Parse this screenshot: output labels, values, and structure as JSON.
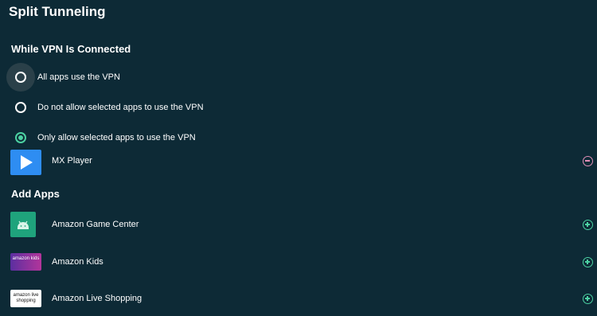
{
  "header": {
    "title": "Split Tunneling"
  },
  "vpn_section": {
    "title": "While VPN Is Connected",
    "options": [
      {
        "label": "All apps use the VPN",
        "selected": false,
        "focused": true
      },
      {
        "label": "Do not allow selected apps to use the VPN",
        "selected": false,
        "focused": false
      },
      {
        "label": "Only allow selected apps to use the VPN",
        "selected": true,
        "focused": false
      }
    ]
  },
  "selected_apps": [
    {
      "name": "MX Player",
      "icon": "mx-player-icon",
      "action": "remove-circle-icon"
    }
  ],
  "add_apps": {
    "title": "Add Apps",
    "items": [
      {
        "name": "Amazon Game Center",
        "icon": "android-icon",
        "action": "add-circle-icon"
      },
      {
        "name": "Amazon Kids",
        "icon": "amazon-kids-icon",
        "action": "add-circle-icon",
        "icon_text": "amazon kids"
      },
      {
        "name": "Amazon Live Shopping",
        "icon": "amazon-live-icon",
        "action": "add-circle-icon",
        "icon_text": "amazon live shopping"
      }
    ]
  },
  "colors": {
    "background": "#0d2a36",
    "accent": "#4cd1a2",
    "remove": "#e08fb7"
  }
}
